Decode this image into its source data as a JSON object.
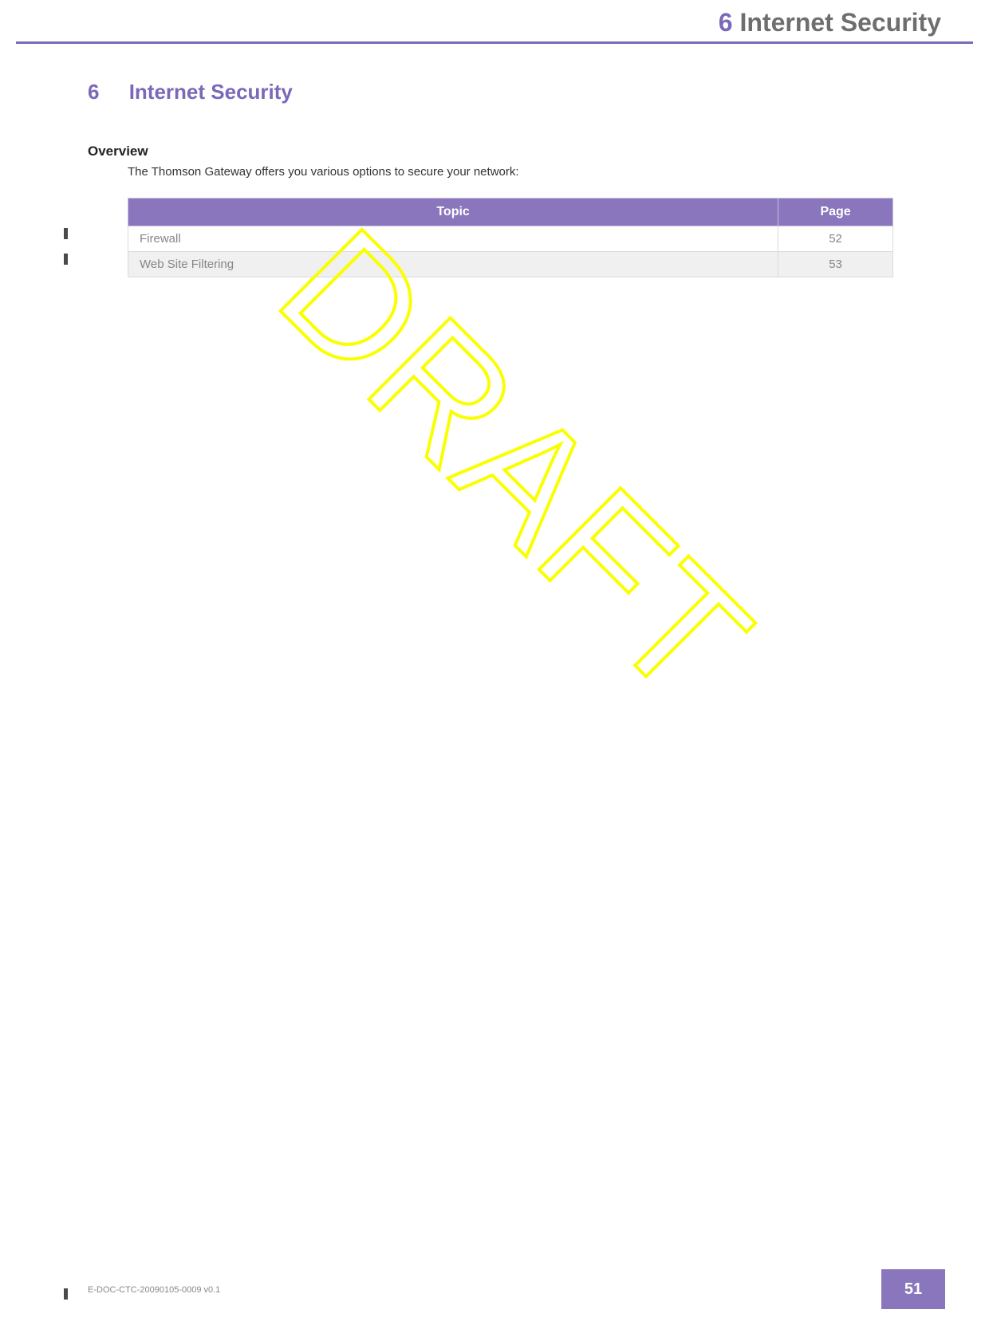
{
  "header": {
    "number": "6",
    "title": "Internet Security"
  },
  "chapter": {
    "number": "6",
    "title": "Internet Security"
  },
  "section": {
    "title": "Overview",
    "intro": "The Thomson Gateway offers you various options to secure your network:"
  },
  "table": {
    "headers": {
      "topic": "Topic",
      "page": "Page"
    },
    "rows": [
      {
        "topic": "Firewall",
        "page": "52"
      },
      {
        "topic": "Web Site Filtering",
        "page": "53"
      }
    ]
  },
  "watermark": "DRAFT",
  "footer": {
    "docid": "E-DOC-CTC-20090105-0009 v0.1",
    "page": "51"
  }
}
